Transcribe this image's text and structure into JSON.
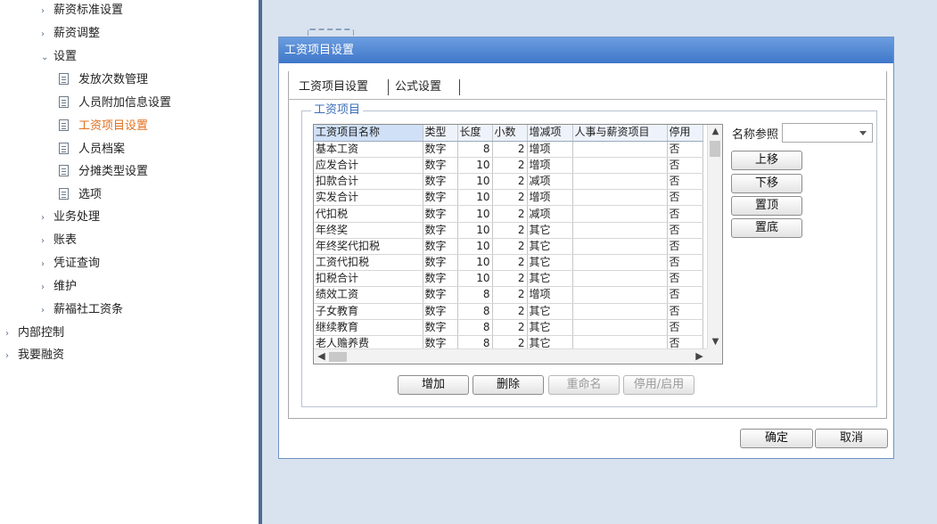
{
  "nav": {
    "items": [
      {
        "label": "薪资标准设置",
        "chev": "›"
      },
      {
        "label": "薪资调整",
        "chev": "›"
      },
      {
        "label": "设置",
        "chev": "⌄"
      },
      {
        "label": "发放次数管理"
      },
      {
        "label": "人员附加信息设置"
      },
      {
        "label": "工资项目设置"
      },
      {
        "label": "人员档案"
      },
      {
        "label": "分摊类型设置"
      },
      {
        "label": "选项"
      },
      {
        "label": "业务处理",
        "chev": "›"
      },
      {
        "label": "账表",
        "chev": "›"
      },
      {
        "label": "凭证查询",
        "chev": "›"
      },
      {
        "label": "维护",
        "chev": "›"
      },
      {
        "label": "薪福社工资条",
        "chev": "›"
      },
      {
        "label": "内部控制",
        "chev": "›"
      },
      {
        "label": "我要融资",
        "chev": "›"
      }
    ]
  },
  "dialog": {
    "title": "工资项目设置",
    "tabs": [
      "工资项目设置",
      "公式设置"
    ],
    "group_title": "工资项目",
    "refer_label": "名称参照",
    "refer_value": "",
    "move_buttons": [
      "上移",
      "下移",
      "置顶",
      "置底"
    ],
    "action_buttons": [
      "增加",
      "删除",
      "重命名",
      "停用/启用"
    ],
    "ok_label": "确定",
    "cancel_label": "取消"
  },
  "grid": {
    "columns": [
      "工资项目名称",
      "类型",
      "长度",
      "小数",
      "增减项",
      "人事与薪资项目",
      "停用"
    ],
    "rows": [
      [
        "基本工资",
        "数字",
        "8",
        "2",
        "增项",
        "",
        "否"
      ],
      [
        "应发合计",
        "数字",
        "10",
        "2",
        "增项",
        "",
        "否"
      ],
      [
        "扣款合计",
        "数字",
        "10",
        "2",
        "减项",
        "",
        "否"
      ],
      [
        "实发合计",
        "数字",
        "10",
        "2",
        "增项",
        "",
        "否"
      ],
      [
        "代扣税",
        "数字",
        "10",
        "2",
        "减项",
        "",
        "否"
      ],
      [
        "年终奖",
        "数字",
        "10",
        "2",
        "其它",
        "",
        "否"
      ],
      [
        "年终奖代扣税",
        "数字",
        "10",
        "2",
        "其它",
        "",
        "否"
      ],
      [
        "工资代扣税",
        "数字",
        "10",
        "2",
        "其它",
        "",
        "否"
      ],
      [
        "扣税合计",
        "数字",
        "10",
        "2",
        "其它",
        "",
        "否"
      ],
      [
        "绩效工资",
        "数字",
        "8",
        "2",
        "增项",
        "",
        "否"
      ],
      [
        "子女教育",
        "数字",
        "8",
        "2",
        "其它",
        "",
        "否"
      ],
      [
        "继续教育",
        "数字",
        "8",
        "2",
        "其它",
        "",
        "否"
      ],
      [
        "老人赡养费",
        "数字",
        "8",
        "2",
        "其它",
        "",
        "否"
      ]
    ]
  },
  "colors": {
    "accent": "#e07020",
    "title_bar": "#4a82d0",
    "legend": "#3d6fb8",
    "splitter": "#4e6a96",
    "content_bg": "#d9e3ef"
  }
}
